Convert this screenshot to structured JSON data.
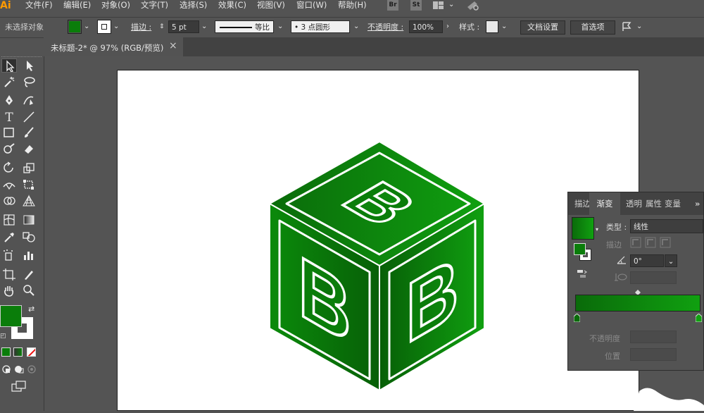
{
  "app": {
    "logo": "Ai"
  },
  "menu": [
    "文件(F)",
    "编辑(E)",
    "对象(O)",
    "文字(T)",
    "选择(S)",
    "效果(C)",
    "视图(V)",
    "窗口(W)",
    "帮助(H)"
  ],
  "menu_buttons": {
    "br": "Br",
    "st": "St"
  },
  "control": {
    "selection": "未选择对象",
    "stroke_label": "描边 :",
    "stroke_weight": "5 pt",
    "stroke_profile": "等比",
    "brush": "• 3 点圆形",
    "opacity_label": "不透明度 :",
    "opacity_value": "100%",
    "style_label": "样式 :",
    "doc_setup": "文档设置",
    "preferences": "首选项"
  },
  "tab": {
    "title": "未标题-2* @ 97% (RGB/预览)",
    "close": "×"
  },
  "colors": {
    "fill": "#0a7d0a",
    "accent": "#ff9a00",
    "grad_start": "#0a6b0a",
    "grad_end": "#10a010"
  },
  "gradient_panel": {
    "tabs": [
      "描边",
      "渐变",
      "透明",
      "属性",
      "变量"
    ],
    "more": "»",
    "type_label": "类型 :",
    "type_value": "线性",
    "stroke_label": "描边",
    "angle_value": "0°",
    "opacity_label": "不透明度",
    "location_label": "位置"
  },
  "artwork": {
    "letter": "B"
  }
}
